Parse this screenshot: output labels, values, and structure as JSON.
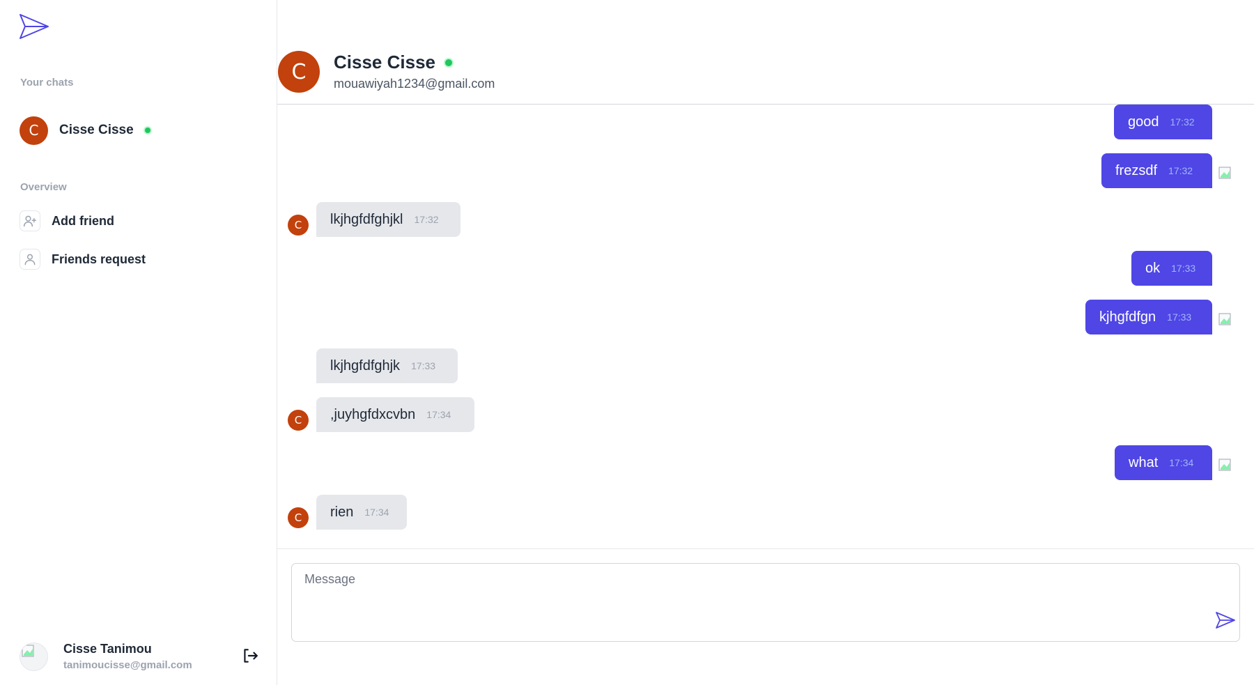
{
  "sidebar": {
    "chats_label": "Your chats",
    "chats": [
      {
        "initial": "C",
        "name": "Cisse Cisse",
        "online": true
      }
    ],
    "overview_label": "Overview",
    "nav": [
      {
        "label": "Add friend",
        "icon": "user-plus-icon"
      },
      {
        "label": "Friends request",
        "icon": "user-icon"
      }
    ],
    "user": {
      "name": "Cisse Tanimou",
      "email": "tanimoucisse@gmail.com"
    }
  },
  "header": {
    "initial": "C",
    "name": "Cisse Cisse",
    "email": "mouawiyah1234@gmail.com",
    "online": true
  },
  "messages": [
    {
      "direction": "out",
      "text": "good",
      "time": "17:32"
    },
    {
      "direction": "out",
      "text": "frezsdf",
      "time": "17:32"
    },
    {
      "direction": "in",
      "text": "lkjhgfdfghjkl",
      "time": "17:32",
      "initial": "C"
    },
    {
      "direction": "out",
      "text": "ok",
      "time": "17:33"
    },
    {
      "direction": "out",
      "text": "kjhgfdfgn",
      "time": "17:33"
    },
    {
      "direction": "in",
      "text": "lkjhgfdfghjk",
      "time": "17:33"
    },
    {
      "direction": "in",
      "text": ",juyhgfdxcvbn",
      "time": "17:34",
      "initial": "C"
    },
    {
      "direction": "out",
      "text": "what",
      "time": "17:34"
    },
    {
      "direction": "in",
      "text": "rien",
      "time": "17:34",
      "initial": "C"
    }
  ],
  "composer": {
    "placeholder": "Message",
    "value": ""
  },
  "colors": {
    "accent": "#4f46e5",
    "avatar": "#c2410c",
    "online": "#22c55e",
    "incoming_bubble": "#e5e7eb"
  }
}
